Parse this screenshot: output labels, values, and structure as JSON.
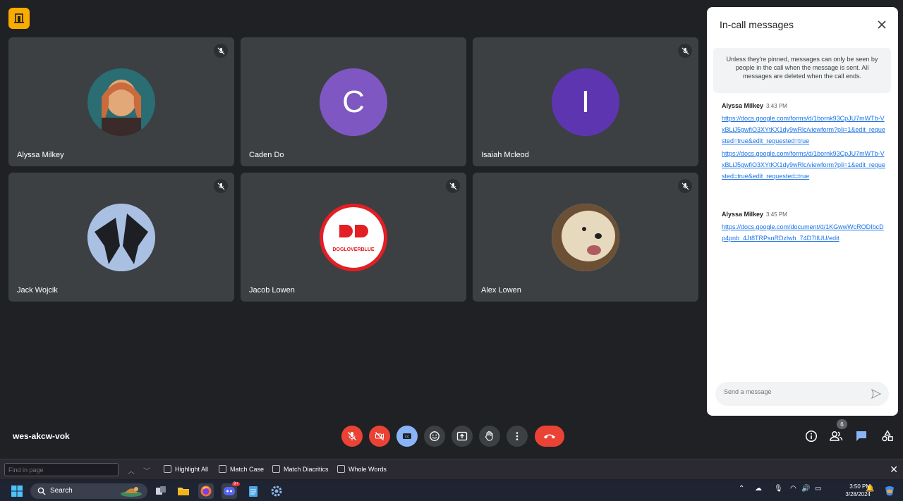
{
  "meeting": {
    "code": "wes-akcw-vok"
  },
  "participants": [
    {
      "name": "Alyssa Milkey",
      "avatar_type": "photo",
      "muted": true
    },
    {
      "name": "Caden Do",
      "avatar_type": "letter",
      "initial": "C",
      "color": "#7e57c2",
      "muted": false
    },
    {
      "name": "Isaiah Mcleod",
      "avatar_type": "letter",
      "initial": "I",
      "color": "#5e35b1",
      "muted": true
    },
    {
      "name": "Jack Wojcik",
      "avatar_type": "photo",
      "muted": true
    },
    {
      "name": "Jacob Lowen",
      "avatar_type": "logo",
      "logo_text": "DOGLOVERBLUE",
      "muted": true
    },
    {
      "name": "Alex Lowen",
      "avatar_type": "photo",
      "muted": true
    }
  ],
  "chat": {
    "title": "In-call messages",
    "notice": "Unless they're pinned, messages can only be seen by people in the call when the message is sent. All messages are deleted when the call ends.",
    "messages": [
      {
        "sender": "Alyssa Milkey",
        "time": "3:43 PM",
        "links": [
          "https://docs.google.com/forms/d/1bornk93CpJU7mWTb-VxBLiJ5gwfiO3XYtKX1dy9wRlc/viewform?pli=1&edit_requested=true&edit_requested=true",
          "https://docs.google.com/forms/d/1bornk93CpJU7mWTb-VxBLiJ5gwfiO3XYtKX1dy9wRlc/viewform?pli=1&edit_requested=true&edit_requested=true"
        ]
      },
      {
        "sender": "Alyssa Milkey",
        "time": "3:45 PM",
        "links": [
          "https://docs.google.com/document/d/1KGwwWcRODIbcDp4pnb_4Jt8TRPsnRDzlwh_74D7lIUU/edit"
        ]
      }
    ],
    "composer_placeholder": "Send a message"
  },
  "controls": {
    "people_count": "6"
  },
  "findbar": {
    "placeholder": "Find in page",
    "options": [
      "Highlight All",
      "Match Case",
      "Match Diacritics",
      "Whole Words"
    ]
  },
  "taskbar": {
    "search_label": "Search",
    "time": "3:50 PM",
    "date": "3/28/2024",
    "discord_badge": "9+"
  },
  "colors": {
    "accent_red": "#ea4335",
    "accent_blue": "#8ab4f8",
    "link": "#1a73e8",
    "tile_bg": "#3c4043",
    "page_bg": "#202124"
  }
}
